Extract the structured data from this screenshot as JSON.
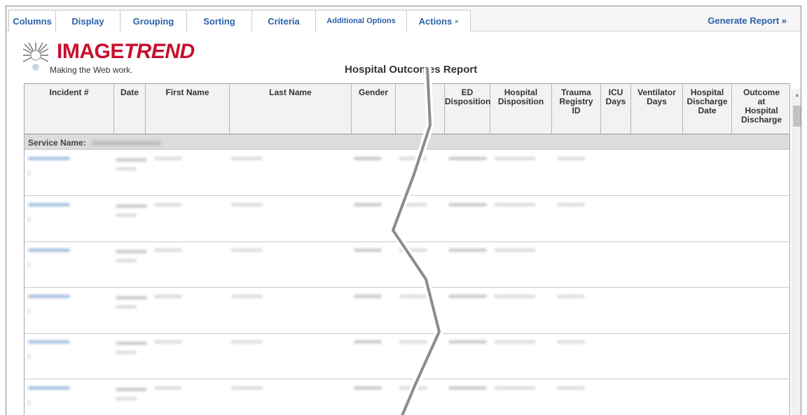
{
  "toolbar": {
    "tabs": [
      "Columns",
      "Display",
      "Grouping",
      "Sorting",
      "Criteria",
      "Additional Options",
      "Actions"
    ],
    "generate_label": "Generate Report »"
  },
  "logo": {
    "brand_main": "IMAGE",
    "brand_italic": "TREND",
    "tagline": "Making the Web work."
  },
  "report": {
    "title": "Hospital Outcomes Report"
  },
  "table": {
    "columns": [
      "Incident #",
      "Date",
      "First Name",
      "Last Name",
      "Gender",
      "",
      "ED\nDisposition",
      "Hospital\nDisposition",
      "Trauma\nRegistry\nID",
      "ICU\nDays",
      "Ventilator\nDays",
      "Hospital\nDischarge\nDate",
      "Outcome\nat\nHospital\nDischarge"
    ],
    "service_label": "Service Name:"
  },
  "colors": {
    "link_blue": "#2a62a8",
    "brand_red": "#c8102e",
    "header_bg": "#f2f2f2",
    "group_bg": "#dcdcdc"
  },
  "icons": {
    "actions_chevron": "double-chevron-down-icon",
    "logo_mark": "starburst-logo-icon"
  }
}
